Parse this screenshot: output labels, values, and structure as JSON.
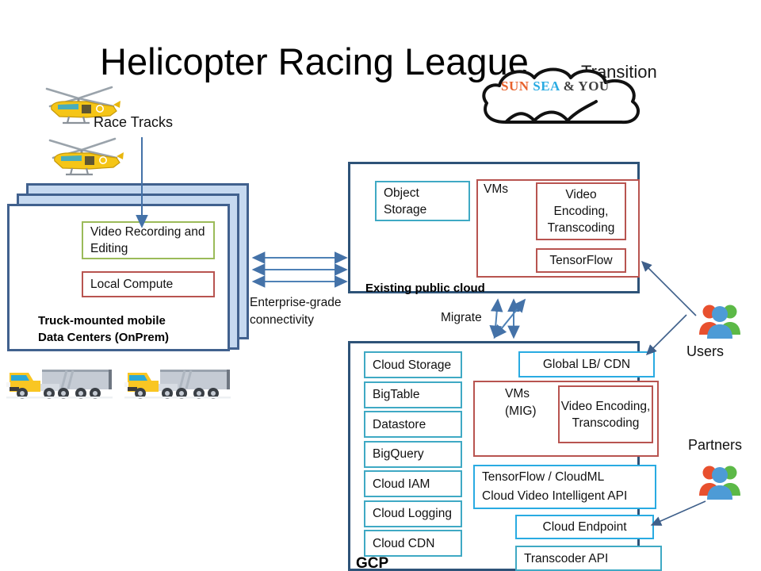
{
  "header": {
    "title": "Helicopter Racing League",
    "subtitle": "Transition",
    "logo": {
      "part1": "SUN ",
      "part2": "SEA ",
      "part3": "& YOU",
      "icon": "cloud-icon",
      "color_sun": "#E8622C",
      "color_sea": "#29ABE2",
      "color_you": "#3f3f3f"
    }
  },
  "labels": {
    "race_tracks": "Race Tracks",
    "enterprise_connectivity": "Enterprise-grade connectivity",
    "migrate": "Migrate",
    "users": "Users",
    "partners": "Partners"
  },
  "onprem": {
    "caption_line1": "Truck-mounted mobile",
    "caption_line2": "Data Centers (OnPrem)",
    "boxes": [
      {
        "label": "Video Recording and Editing",
        "border_color": "#9BBB59"
      },
      {
        "label": "Local Compute",
        "border_color": "#B85450"
      }
    ],
    "card_fill": "#C6D9F0",
    "card_border": "#41618E",
    "icons": [
      "helicopter-icon",
      "helicopter-icon",
      "truck-icon",
      "truck-icon"
    ]
  },
  "existing_public_cloud": {
    "title": "Existing public cloud",
    "border_color": "#2E5378",
    "object_storage": "Object Storage",
    "vms_label": "VMs",
    "vms_border_color": "#B85450",
    "video_encoding": "Video Encoding, Transcoding",
    "tensorflow": "TensorFlow"
  },
  "gcp": {
    "title": "GCP",
    "border_color": "#2E5378",
    "left_services": [
      "Cloud Storage",
      "BigTable",
      "Datastore",
      "BigQuery",
      "Cloud IAM",
      "Cloud Logging",
      "Cloud CDN"
    ],
    "global_lb": "Global LB/ CDN",
    "vms_label_line1": "VMs",
    "vms_label_line2": "(MIG)",
    "video_encoding": "Video Encoding, Transcoding",
    "ml_line1": "TensorFlow / CloudML",
    "ml_line2": "Cloud Video Intelligent API",
    "cloud_endpoint": "Cloud Endpoint",
    "transcoder_api": "Transcoder API",
    "accent_teal": "#3FA9C4",
    "accent_blue": "#29ABE2"
  },
  "actors": [
    {
      "name": "Users",
      "icon": "people-group-icon"
    },
    {
      "name": "Partners",
      "icon": "people-group-icon"
    }
  ],
  "connections": {
    "arrow_color": "#4472A8",
    "enterprise_arrow_count": 3,
    "migrate_arrow_count": 3
  }
}
